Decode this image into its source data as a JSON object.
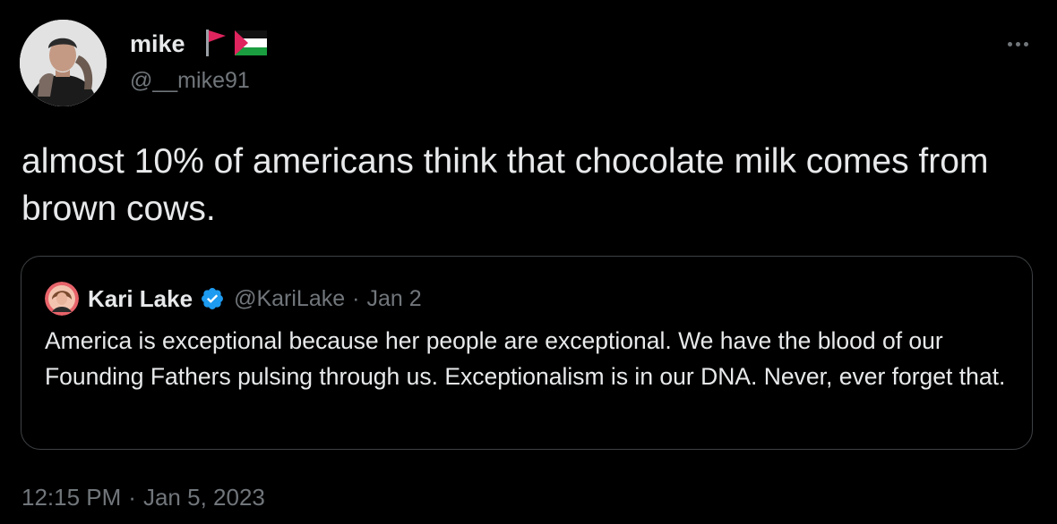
{
  "author": {
    "name": "mike",
    "handle": "@__mike91",
    "avatar_icon": "user-avatar-photo",
    "flags": [
      "red-flag-icon",
      "palestine-flag-icon"
    ]
  },
  "tweet": {
    "text": "almost 10% of americans think that chocolate milk comes from brown cows."
  },
  "quote": {
    "name": "Kari Lake",
    "verified_icon": "verified-badge-icon",
    "handle": "@KariLake",
    "separator": "·",
    "date": "Jan 2",
    "text": "America is exceptional because her people are exceptional. We have the blood of our Founding Fathers pulsing through us. Exceptionalism is in our DNA. Never, ever forget that."
  },
  "timestamp": {
    "time": "12:15 PM",
    "separator": "·",
    "date": "Jan 5, 2023"
  },
  "more_icon": "more-horizontal-icon",
  "colors": {
    "background": "#000000",
    "primary_text": "#e7e9ea",
    "secondary_text": "#71767b",
    "border": "#3e4144",
    "verified": "#1d9bf0",
    "flag_red": "#e0245e"
  }
}
